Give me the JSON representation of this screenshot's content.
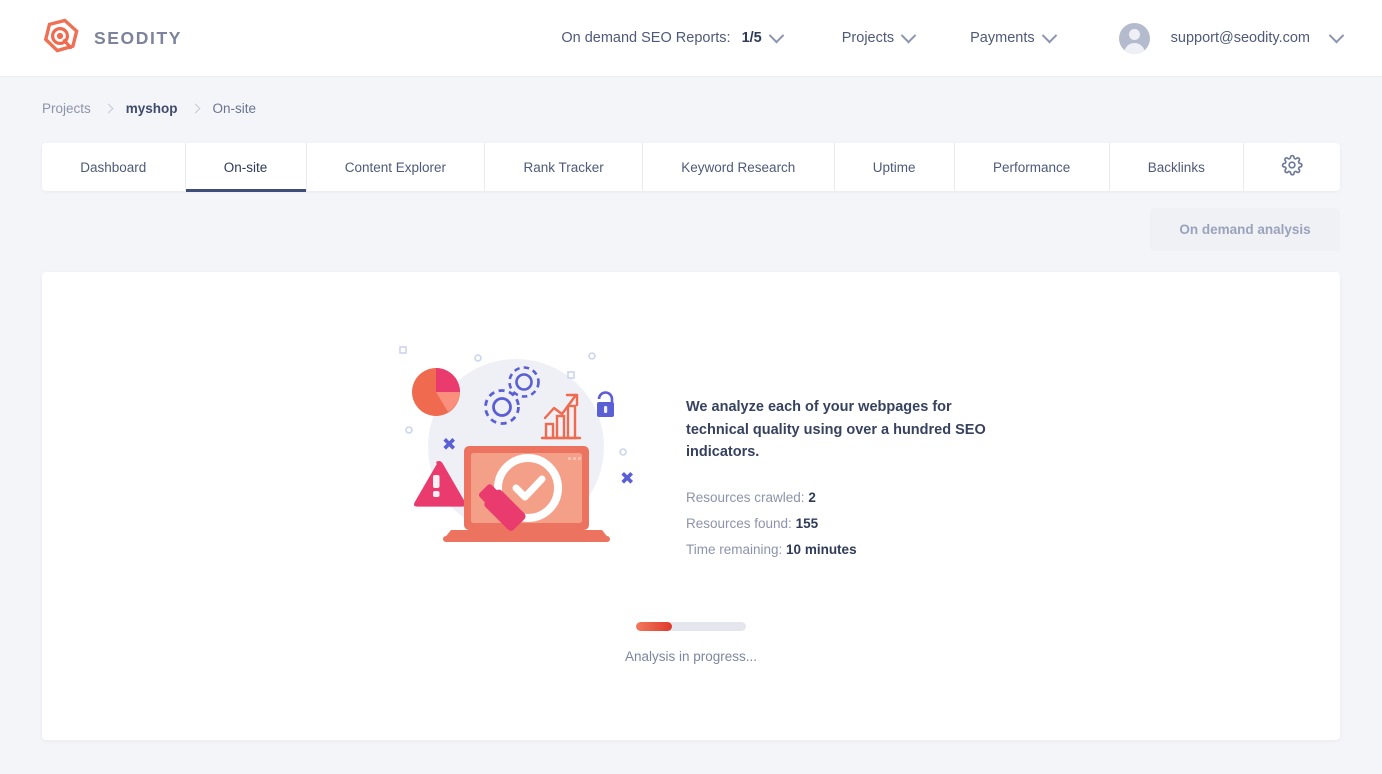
{
  "header": {
    "brand_name": "SEODITY",
    "logo_icon": "seodity-hex-magnifier-logo",
    "reports_label": "On demand SEO Reports:",
    "reports_quota": "1/5",
    "projects_label": "Projects",
    "payments_label": "Payments",
    "user_email": "support@seodity.com",
    "avatar_icon": "user-avatar-icon",
    "chevron_icon": "chevron-down-icon"
  },
  "breadcrumb": {
    "items": [
      {
        "label": "Projects"
      },
      {
        "label": "myshop"
      },
      {
        "label": "On-site"
      }
    ],
    "separator_icon": "chevron-right-icon"
  },
  "tabs": {
    "items": [
      {
        "label": "Dashboard",
        "active": false
      },
      {
        "label": "On-site",
        "active": true
      },
      {
        "label": "Content Explorer",
        "active": false
      },
      {
        "label": "Rank Tracker",
        "active": false
      },
      {
        "label": "Keyword Research",
        "active": false
      },
      {
        "label": "Uptime",
        "active": false
      },
      {
        "label": "Performance",
        "active": false
      },
      {
        "label": "Backlinks",
        "active": false
      }
    ],
    "settings_icon": "gear-icon"
  },
  "toolbar": {
    "ondemand_label": "On demand analysis"
  },
  "main": {
    "illustration_icon": "seo-audit-laptop-illustration",
    "headline": "We analyze each of your webpages for technical quality using over a hundred SEO indicators.",
    "stats": [
      {
        "label": "Resources crawled:",
        "value": "2"
      },
      {
        "label": "Resources found:",
        "value": "155"
      },
      {
        "label": "Time remaining:",
        "value": "10 minutes"
      }
    ],
    "progress": {
      "percent": 33,
      "status": "Analysis in progress..."
    }
  },
  "colors": {
    "accent_red": "#e0392c",
    "accent_orange": "#f0795c",
    "accent_pink": "#e93b6e",
    "accent_purple": "#5b5fd6",
    "text_dark": "#2f3b58",
    "text_muted": "#8c94ab",
    "page_bg": "#f4f5f8"
  }
}
